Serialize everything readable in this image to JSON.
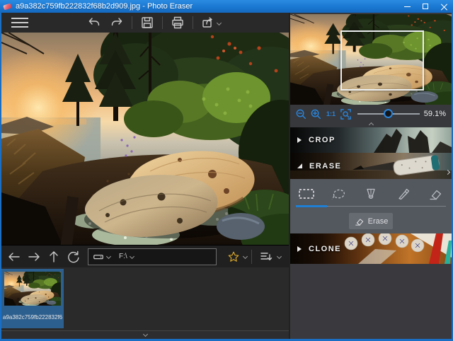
{
  "window": {
    "title": "a9a382c759fb222832f68b2d909.jpg - Photo Eraser"
  },
  "toolbar": {
    "icons": [
      "menu",
      "undo",
      "redo",
      "save",
      "print",
      "share"
    ]
  },
  "navigator": {
    "zoom_percent": "59.1%",
    "actual_size_label": "1:1"
  },
  "panels": {
    "crop": {
      "label": "CROP"
    },
    "erase": {
      "label": "ERASE",
      "tools": [
        "rect-select",
        "lasso-select",
        "polygon-select",
        "brush",
        "eraser"
      ],
      "selected_tool": "rect-select",
      "erase_button_label": "Erase"
    },
    "clone": {
      "label": "CLONE"
    }
  },
  "path_bar": {
    "drive": "F:\\"
  },
  "filmstrip": {
    "selected_thumb_label": "a9a382c759fb222832f68b2..."
  },
  "colors": {
    "titlebar_blue": "#1a78d2",
    "accent_blue": "#2a84da",
    "selection_blue": "#2d5f8e"
  }
}
